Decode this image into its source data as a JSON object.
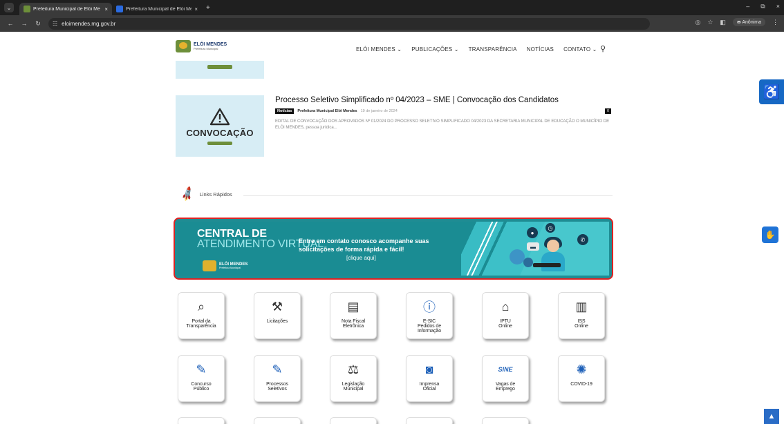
{
  "browser": {
    "tabs": [
      {
        "title": "Prefeitura Municipal de Elói Me",
        "close": "×",
        "active": true
      },
      {
        "title": "Prefeitura Municipal de Elói Me",
        "close": "×",
        "active": false
      }
    ],
    "new_tab": "+",
    "url": "eloimendes.mg.gov.br",
    "profile_label": "Anônima",
    "window_controls": [
      "–",
      "⧉",
      "×"
    ]
  },
  "site": {
    "logo_title": "ELÓI MENDES",
    "logo_subtitle": "Prefeitura Municipal",
    "nav": [
      "ELÓI MENDES ⌄",
      "PUBLICAÇÕES ⌄",
      "TRANSPARÊNCIA",
      "NOTÍCIAS",
      "CONTATO ⌄"
    ]
  },
  "post": {
    "thumb_text": "CONVOCAÇÃO",
    "title": "Processo Seletivo Simplificado nº 04/2023 – SME | Convocação dos Candidatos",
    "category": "Notícias",
    "author": "Prefeitura Municipal Elói Mendes",
    "date": "19 de janeiro de 2024",
    "comments": "0",
    "excerpt": "EDITAL DE CONVOCAÇÃO DOS APROVADOS Nº 01/2024 DO PROCESSO SELETIVO SIMPLIFICADO 04/2023 DA SECRETARIA MUNICIPAL DE EDUCAÇÃO O MUNICÍPIO DE ELÓI MENDES, pessoa jurídica..."
  },
  "links_rapidos": {
    "title": "Links Rápidos"
  },
  "banner": {
    "line1": "CENTRAL DE",
    "line2": "ATENDIMENTO VIRTUAL",
    "logo_title": "ELÓI MENDES",
    "logo_sub": "Prefeitura Municipal",
    "text": "Entre em contato conosco acompanhe suas solicitações de forma rápida e fácil!",
    "cta": "[clique aqui]"
  },
  "quick_links": [
    {
      "label": "Portal da\nTransparência",
      "icon": "search-doc-icon"
    },
    {
      "label": "Licitações",
      "icon": "gavel-icon"
    },
    {
      "label": "Nota Fiscal\nEletrônica",
      "icon": "invoice-icon"
    },
    {
      "label": "E-SIC\nPedidos de\nInformação",
      "icon": "info-icon"
    },
    {
      "label": "IPTU\nOnline",
      "icon": "house-icon"
    },
    {
      "label": "ISS\nOnline",
      "icon": "document-icon"
    },
    {
      "label": "Concurso\nPúblico",
      "icon": "edit-doc-icon"
    },
    {
      "label": "Processos\nSeletivos",
      "icon": "edit-doc-icon"
    },
    {
      "label": "Legislação\nMunicipal",
      "icon": "scales-icon"
    },
    {
      "label": "Imprensa\nOficial",
      "icon": "camera-icon"
    },
    {
      "label": "Vagas de\nEmprego",
      "icon": "sine-icon"
    },
    {
      "label": "COVID-19",
      "icon": "virus-icon"
    }
  ],
  "colors": {
    "banner_bg": "#1a8c93",
    "highlight_border": "#dd2222",
    "accessibility_blue": "#1668c4"
  }
}
